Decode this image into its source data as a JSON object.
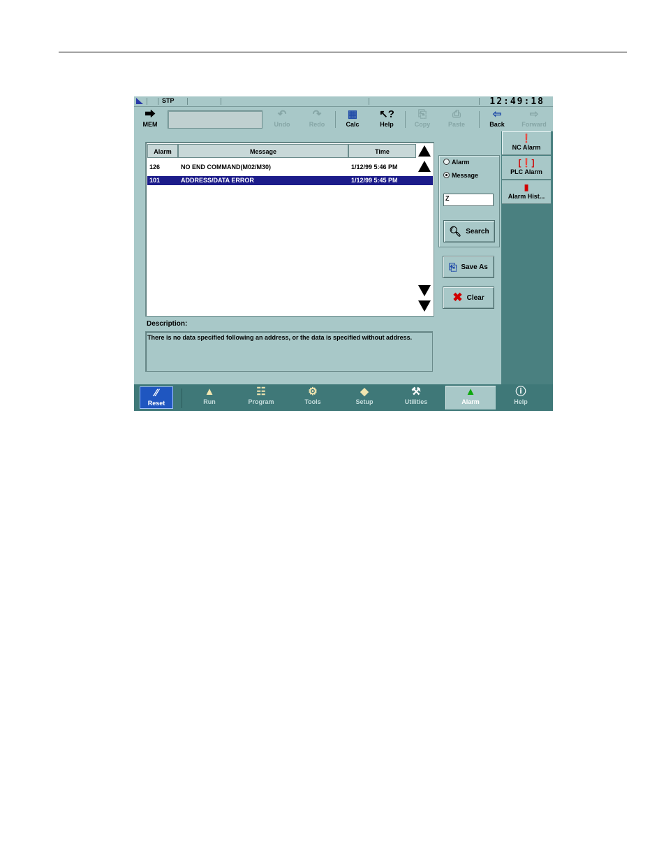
{
  "status": {
    "mode": "STP",
    "clock": "12:49:18"
  },
  "toolbar": {
    "mem_label": "MEM",
    "undo_label": "Undo",
    "redo_label": "Redo",
    "calc_label": "Calc",
    "help_label": "Help",
    "copy_label": "Copy",
    "paste_label": "Paste",
    "back_label": "Back",
    "forward_label": "Forward"
  },
  "side_tabs": {
    "nc_alarm": "NC Alarm",
    "plc_alarm": "PLC Alarm",
    "alarm_history": "Alarm Hist..."
  },
  "table": {
    "columns": [
      "Alarm",
      "Message",
      "Time"
    ],
    "rows": [
      {
        "alarm": "126",
        "message": "NO END COMMAND(M02/M30)",
        "time": "1/12/99 5:46 PM"
      },
      {
        "alarm": "101",
        "message": "ADDRESS/DATA ERROR",
        "time": "1/12/99 5:45 PM"
      }
    ]
  },
  "search": {
    "option_alarm": "Alarm",
    "option_message": "Message",
    "selected": "Message",
    "query": "Z",
    "button_label": "Search"
  },
  "actions": {
    "save_as_label": "Save As",
    "clear_label": "Clear"
  },
  "description": {
    "label": "Description:",
    "text": "There is no data specified following an address, or the data is specified without address."
  },
  "nav": {
    "reset": "Reset",
    "run": "Run",
    "program": "Program",
    "tools": "Tools",
    "setup": "Setup",
    "utilities": "Utilities",
    "alarm": "Alarm",
    "help": "Help"
  },
  "colors": {
    "panel": "#a8c8c8",
    "side_panel": "#4a8080",
    "nav_bar": "#3f7878",
    "selection": "#1c1c8a",
    "reset_button": "#1f56c0"
  }
}
